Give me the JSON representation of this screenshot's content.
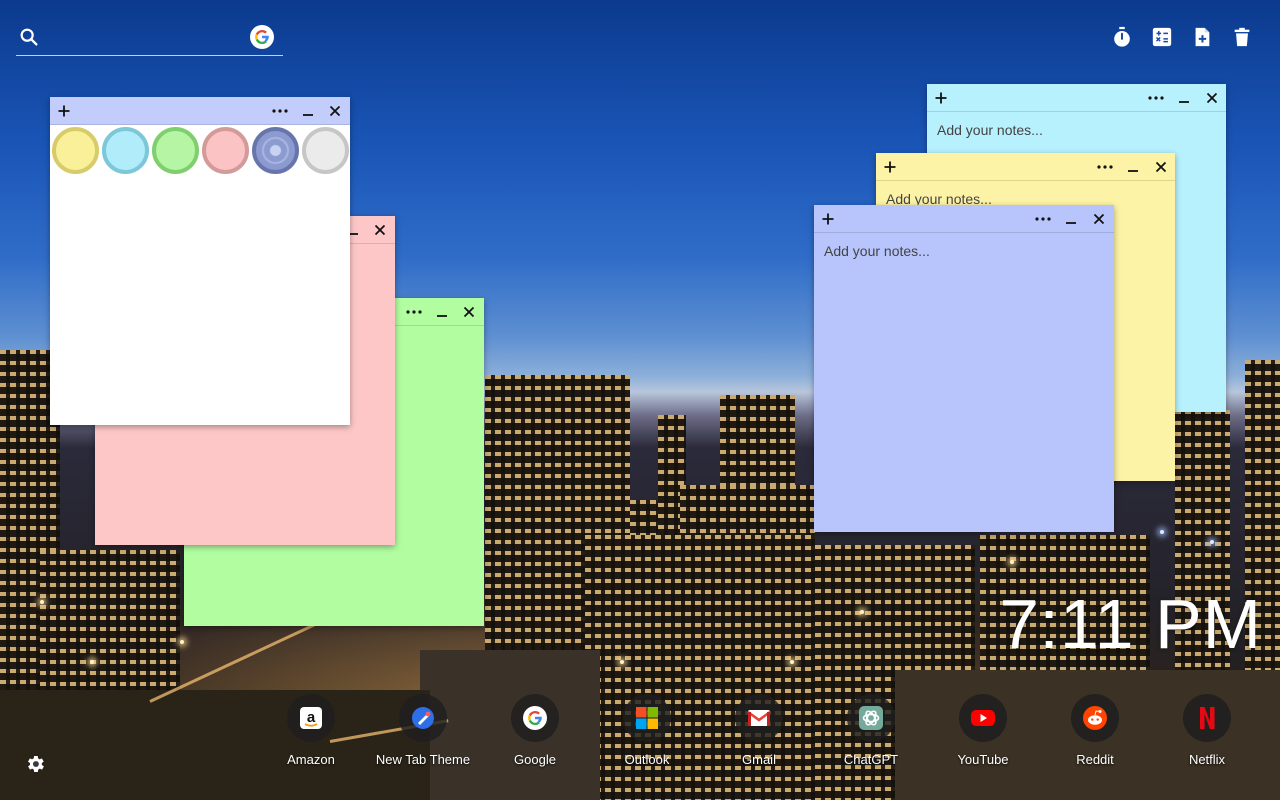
{
  "search": {
    "placeholder": "",
    "value": ""
  },
  "tools": [
    {
      "name": "timer-icon"
    },
    {
      "name": "calculator-icon"
    },
    {
      "name": "new-note-icon"
    },
    {
      "name": "trash-icon"
    }
  ],
  "notes": {
    "white": {
      "color": "#ffffff",
      "header": "#c2cdfb"
    },
    "pink": {
      "color": "#fdc7c7",
      "text": ""
    },
    "green": {
      "color": "#b1fda0",
      "text": ""
    },
    "cyan": {
      "color": "#b7f1fd",
      "text": "Add your notes..."
    },
    "yellow": {
      "color": "#fdf3a6",
      "text": "Add your notes..."
    },
    "blue": {
      "color": "#b7c5fc",
      "text": "Add your notes..."
    }
  },
  "palette": [
    {
      "color": "#fbf09a",
      "ring": "#d8cb6a"
    },
    {
      "color": "#b1ecfa",
      "ring": "#7cc7d8"
    },
    {
      "color": "#b5f5a3",
      "ring": "#7fcf6f"
    },
    {
      "color": "#fbc3c3",
      "ring": "#d39a9a"
    },
    {
      "color": "#8b9bd0",
      "ring": "#6676ad",
      "selected": true
    },
    {
      "color": "#ebebeb",
      "ring": "#c6c6c6"
    }
  ],
  "clock": {
    "time": "7:11 PM"
  },
  "shortcuts": [
    {
      "label": "Amazon",
      "icon": "amazon-icon"
    },
    {
      "label": "New Tab Theme",
      "icon": "new-tab-theme-icon"
    },
    {
      "label": "Google",
      "icon": "google-icon"
    },
    {
      "label": "Outlook",
      "icon": "outlook-icon"
    },
    {
      "label": "Gmail",
      "icon": "gmail-icon"
    },
    {
      "label": "ChatGPT",
      "icon": "chatgpt-icon"
    },
    {
      "label": "YouTube",
      "icon": "youtube-icon"
    },
    {
      "label": "Reddit",
      "icon": "reddit-icon"
    },
    {
      "label": "Netflix",
      "icon": "netflix-icon"
    }
  ],
  "settings": {
    "icon": "gear-icon"
  }
}
